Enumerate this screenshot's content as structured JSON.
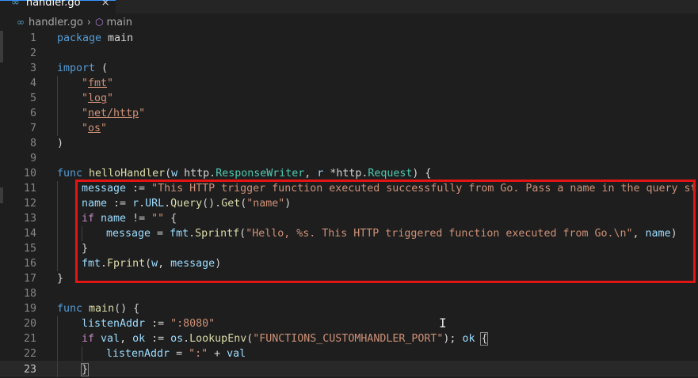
{
  "tab": {
    "icon": "go-file-icon",
    "title": "handler.go",
    "close": "×"
  },
  "breadcrumb": {
    "file": "handler.go",
    "separator": "›",
    "symbol": "main"
  },
  "current_line": 23,
  "highlight_color": "#e31414",
  "lines": [
    {
      "n": "1",
      "tokens": [
        [
          "kw",
          "package"
        ],
        [
          "pl",
          " main"
        ]
      ]
    },
    {
      "n": "2",
      "tokens": []
    },
    {
      "n": "3",
      "tokens": [
        [
          "kw",
          "import"
        ],
        [
          "pl",
          " ("
        ]
      ]
    },
    {
      "n": "4",
      "indent": 1,
      "tokens": [
        [
          "str",
          "\""
        ],
        [
          "imp",
          "fmt"
        ],
        [
          "str",
          "\""
        ]
      ]
    },
    {
      "n": "5",
      "indent": 1,
      "tokens": [
        [
          "str",
          "\""
        ],
        [
          "imp",
          "log"
        ],
        [
          "str",
          "\""
        ]
      ]
    },
    {
      "n": "6",
      "indent": 1,
      "tokens": [
        [
          "str",
          "\""
        ],
        [
          "imp",
          "net/http"
        ],
        [
          "str",
          "\""
        ]
      ]
    },
    {
      "n": "7",
      "indent": 1,
      "tokens": [
        [
          "str",
          "\""
        ],
        [
          "imp",
          "os"
        ],
        [
          "str",
          "\""
        ]
      ]
    },
    {
      "n": "8",
      "tokens": [
        [
          "pl",
          ")"
        ]
      ]
    },
    {
      "n": "9",
      "tokens": []
    },
    {
      "n": "10",
      "tokens": [
        [
          "kw",
          "func"
        ],
        [
          "pl",
          " "
        ],
        [
          "fn",
          "helloHandler"
        ],
        [
          "pl",
          "("
        ],
        [
          "var",
          "w"
        ],
        [
          "pl",
          " http."
        ],
        [
          "typ",
          "ResponseWriter"
        ],
        [
          "pl",
          ", "
        ],
        [
          "var",
          "r"
        ],
        [
          "pl",
          " *http."
        ],
        [
          "typ",
          "Request"
        ],
        [
          "pl",
          ") {"
        ]
      ]
    },
    {
      "n": "11",
      "indent": 1,
      "tokens": [
        [
          "var",
          "message"
        ],
        [
          "pl",
          " := "
        ],
        [
          "str",
          "\"This HTTP trigger function executed successfully from Go. Pass a name in the query string"
        ]
      ]
    },
    {
      "n": "12",
      "indent": 1,
      "tokens": [
        [
          "var",
          "name"
        ],
        [
          "pl",
          " := "
        ],
        [
          "var",
          "r"
        ],
        [
          "pl",
          "."
        ],
        [
          "var",
          "URL"
        ],
        [
          "pl",
          "."
        ],
        [
          "fn",
          "Query"
        ],
        [
          "pl",
          "()."
        ],
        [
          "fn",
          "Get"
        ],
        [
          "pl",
          "("
        ],
        [
          "str",
          "\"name\""
        ],
        [
          "pl",
          ")"
        ]
      ]
    },
    {
      "n": "13",
      "indent": 1,
      "tokens": [
        [
          "ctl",
          "if"
        ],
        [
          "pl",
          " "
        ],
        [
          "var",
          "name"
        ],
        [
          "pl",
          " != "
        ],
        [
          "str",
          "\"\""
        ],
        [
          "pl",
          " {"
        ]
      ]
    },
    {
      "n": "14",
      "indent": 2,
      "tokens": [
        [
          "var",
          "message"
        ],
        [
          "pl",
          " = "
        ],
        [
          "var",
          "fmt"
        ],
        [
          "pl",
          "."
        ],
        [
          "fn",
          "Sprintf"
        ],
        [
          "pl",
          "("
        ],
        [
          "str",
          "\"Hello, %s. This HTTP triggered function executed from Go.\\n\""
        ],
        [
          "pl",
          ", "
        ],
        [
          "var",
          "name"
        ],
        [
          "pl",
          ")"
        ]
      ]
    },
    {
      "n": "15",
      "indent": 1,
      "tokens": [
        [
          "pl",
          "}"
        ]
      ]
    },
    {
      "n": "16",
      "indent": 1,
      "tokens": [
        [
          "var",
          "fmt"
        ],
        [
          "pl",
          "."
        ],
        [
          "fn",
          "Fprint"
        ],
        [
          "pl",
          "("
        ],
        [
          "var",
          "w"
        ],
        [
          "pl",
          ", "
        ],
        [
          "var",
          "message"
        ],
        [
          "pl",
          ")"
        ]
      ]
    },
    {
      "n": "17",
      "tokens": [
        [
          "pl",
          "}"
        ]
      ]
    },
    {
      "n": "18",
      "tokens": []
    },
    {
      "n": "19",
      "tokens": [
        [
          "kw",
          "func"
        ],
        [
          "pl",
          " "
        ],
        [
          "fn",
          "main"
        ],
        [
          "pl",
          "() {"
        ]
      ]
    },
    {
      "n": "20",
      "indent": 1,
      "tokens": [
        [
          "var",
          "listenAddr"
        ],
        [
          "pl",
          " := "
        ],
        [
          "str",
          "\":8080\""
        ]
      ]
    },
    {
      "n": "21",
      "indent": 1,
      "tokens": [
        [
          "ctl",
          "if"
        ],
        [
          "pl",
          " "
        ],
        [
          "var",
          "val"
        ],
        [
          "pl",
          ", "
        ],
        [
          "var",
          "ok"
        ],
        [
          "pl",
          " := "
        ],
        [
          "var",
          "os"
        ],
        [
          "pl",
          "."
        ],
        [
          "fn",
          "LookupEnv"
        ],
        [
          "pl",
          "("
        ],
        [
          "str",
          "\"FUNCTIONS_CUSTOMHANDLER_PORT\""
        ],
        [
          "pl",
          "); "
        ],
        [
          "var",
          "ok"
        ],
        [
          "pl",
          " "
        ],
        [
          "brk",
          "{"
        ]
      ]
    },
    {
      "n": "22",
      "indent": 2,
      "tokens": [
        [
          "var",
          "listenAddr"
        ],
        [
          "pl",
          " = "
        ],
        [
          "str",
          "\":\""
        ],
        [
          "pl",
          " + "
        ],
        [
          "var",
          "val"
        ]
      ]
    },
    {
      "n": "23",
      "indent": 1,
      "tokens": [
        [
          "brk",
          "}"
        ]
      ]
    }
  ]
}
